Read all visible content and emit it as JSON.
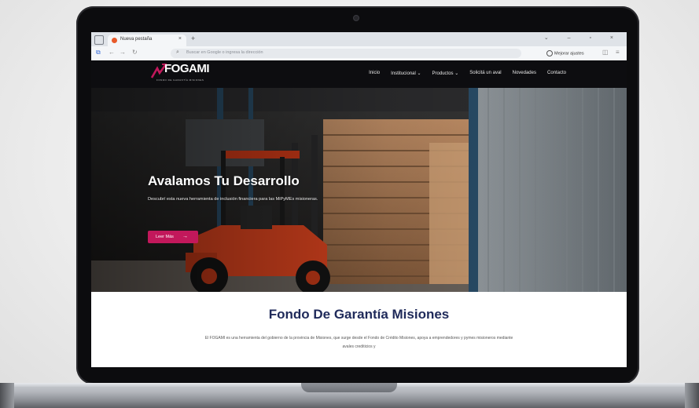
{
  "browser": {
    "tab_title": "Nueva pestaña",
    "tab_close": "×",
    "new_tab": "+",
    "window_controls": "⌄ – ▫ ×",
    "address_placeholder": "Buscar en Google o ingresa la dirección",
    "improve_label": "Mejorar ajustes",
    "icons": [
      "back-icon",
      "forward-icon",
      "reload-icon",
      "search-icon",
      "profile-icon",
      "menu-icon"
    ]
  },
  "site": {
    "logo": "FOGAMI",
    "logo_sub": "FONDO DE GARANTÍA MISIONES",
    "nav": [
      "Inicio",
      "Institucional ⌄",
      "Productos ⌄",
      "Solicitá un aval",
      "Novedades",
      "Contacto"
    ],
    "hero": {
      "title": "Avalamos Tu Desarrollo",
      "description": "Descubrí esta nueva herramienta de inclusión financiera para las MiPyMEs misioneras.",
      "button": "Leer Más",
      "button_arrow": "→"
    },
    "section": {
      "title": "Fondo De Garantía Misiones",
      "text": "El FOGAMI es una herramienta del gobierno de la provincia de Misiones, que surge desde el Fondo de Crédito Misiones, apoya a emprendedores y pymes misioneros mediante avales crediticios y"
    },
    "colors": {
      "brand_accent": "#c2185b",
      "header_bg": "#0d0d10",
      "title_navy": "#1f2a5a",
      "forklift_orange": "#e0451f"
    }
  }
}
